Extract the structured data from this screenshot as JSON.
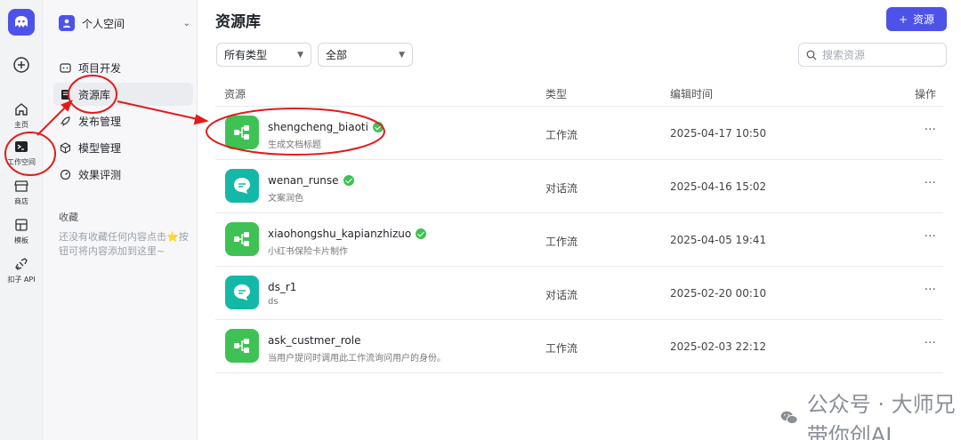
{
  "rail": {
    "items": [
      {
        "label": "主页",
        "icon": "home-icon"
      },
      {
        "label": "工作空间",
        "icon": "workspace-icon"
      },
      {
        "label": "商店",
        "icon": "store-icon"
      },
      {
        "label": "模板",
        "icon": "template-icon"
      },
      {
        "label": "扣子 API",
        "icon": "api-icon"
      }
    ]
  },
  "side": {
    "space_name": "个人空间",
    "nav": [
      {
        "label": "项目开发",
        "icon": "project-icon"
      },
      {
        "label": "资源库",
        "icon": "library-icon"
      },
      {
        "label": "发布管理",
        "icon": "rocket-icon"
      },
      {
        "label": "模型管理",
        "icon": "model-icon"
      },
      {
        "label": "效果评测",
        "icon": "evaluate-icon"
      }
    ],
    "favorites_title": "收藏",
    "favorites_empty": "还没有收藏任何内容点击⭐按钮可将内容添加到这里~"
  },
  "main": {
    "title": "资源库",
    "add_button": "资源",
    "filter_type": "所有类型",
    "filter_scope": "全部",
    "search_placeholder": "搜索资源",
    "columns": {
      "resource": "资源",
      "type": "类型",
      "edited": "编辑时间",
      "action": "操作"
    },
    "rows": [
      {
        "name": "shengcheng_biaoti",
        "desc": "生成文档标题",
        "type": "工作流",
        "time": "2025-04-17 10:50",
        "verified": true,
        "kind": "workflow"
      },
      {
        "name": "wenan_runse",
        "desc": "文案润色",
        "type": "对话流",
        "time": "2025-04-16 15:02",
        "verified": true,
        "kind": "chatflow"
      },
      {
        "name": "xiaohongshu_kapianzhizuo",
        "desc": "小红书保险卡片制作",
        "type": "工作流",
        "time": "2025-04-05 19:41",
        "verified": true,
        "kind": "workflow"
      },
      {
        "name": "ds_r1",
        "desc": "ds",
        "type": "对话流",
        "time": "2025-02-20 00:10",
        "verified": false,
        "kind": "chatflow"
      },
      {
        "name": "ask_custmer_role",
        "desc": "当用户提问时调用此工作流询问用户的身份。",
        "type": "工作流",
        "time": "2025-02-03 22:12",
        "verified": false,
        "kind": "workflow"
      }
    ]
  },
  "watermark": "公众号 · 大师兄带你创AI",
  "colors": {
    "accent": "#4d53e8",
    "workflow": "#3ec254",
    "chatflow": "#14b8a6",
    "annotation": "#e21b1b"
  }
}
